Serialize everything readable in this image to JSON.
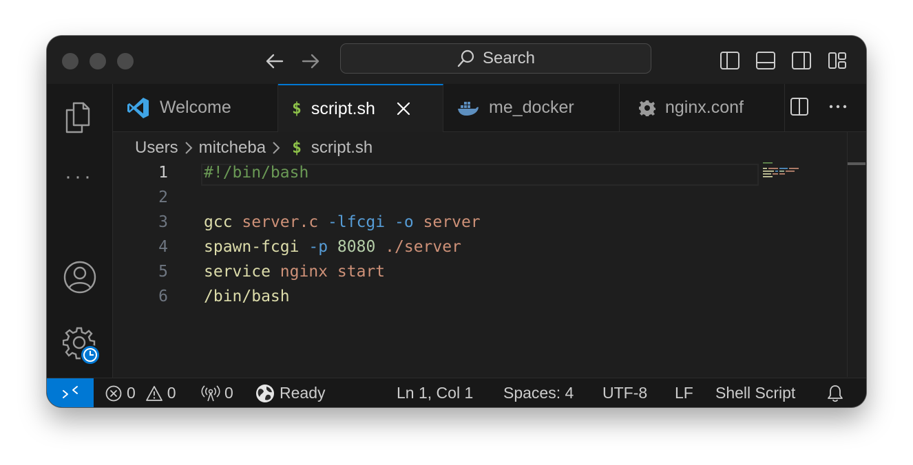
{
  "titlebar": {
    "search_label": "Search"
  },
  "tabs": [
    {
      "label": "Welcome",
      "icon": "vscode-logo-icon",
      "active": false
    },
    {
      "label": "script.sh",
      "icon": "dollar-icon",
      "active": true
    },
    {
      "label": "me_docker",
      "icon": "docker-icon",
      "active": false
    },
    {
      "label": "nginx.conf",
      "icon": "gear-icon",
      "active": false
    }
  ],
  "breadcrumb": {
    "parts": [
      "Users",
      "mitcheba",
      "script.sh"
    ],
    "file_icon": "$"
  },
  "editor": {
    "current_line": 1,
    "line_numbers": [
      "1",
      "2",
      "3",
      "4",
      "5",
      "6"
    ],
    "lines": [
      [
        {
          "t": "#!/bin/bash",
          "c": "green"
        }
      ],
      [],
      [
        {
          "t": "gcc",
          "c": "yellow"
        },
        {
          "t": " ",
          "c": "yellow"
        },
        {
          "t": "server.c",
          "c": "orange"
        },
        {
          "t": " ",
          "c": "yellow"
        },
        {
          "t": "-lfcgi",
          "c": "blue"
        },
        {
          "t": " ",
          "c": "yellow"
        },
        {
          "t": "-o",
          "c": "blue"
        },
        {
          "t": " ",
          "c": "yellow"
        },
        {
          "t": "server",
          "c": "orange"
        }
      ],
      [
        {
          "t": "spawn-fcgi",
          "c": "yellow"
        },
        {
          "t": " ",
          "c": "yellow"
        },
        {
          "t": "-p",
          "c": "blue"
        },
        {
          "t": " ",
          "c": "yellow"
        },
        {
          "t": "8080",
          "c": "num"
        },
        {
          "t": " ",
          "c": "yellow"
        },
        {
          "t": "./server",
          "c": "orange"
        }
      ],
      [
        {
          "t": "service",
          "c": "yellow"
        },
        {
          "t": " ",
          "c": "yellow"
        },
        {
          "t": "nginx",
          "c": "orange"
        },
        {
          "t": " ",
          "c": "yellow"
        },
        {
          "t": "start",
          "c": "orange"
        }
      ],
      [
        {
          "t": "/bin/bash",
          "c": "yellow"
        }
      ]
    ]
  },
  "statusbar": {
    "errors": "0",
    "warnings": "0",
    "ports": "0",
    "ready": "Ready",
    "position": "Ln 1, Col 1",
    "spaces": "Spaces: 4",
    "encoding": "UTF-8",
    "eol": "LF",
    "language": "Shell Script"
  },
  "colors": {
    "accent": "#0078d4",
    "comment": "#6a9955",
    "string": "#ce9178",
    "flag": "#569cd6",
    "number": "#b5cea8",
    "command": "#dcdcaa"
  }
}
